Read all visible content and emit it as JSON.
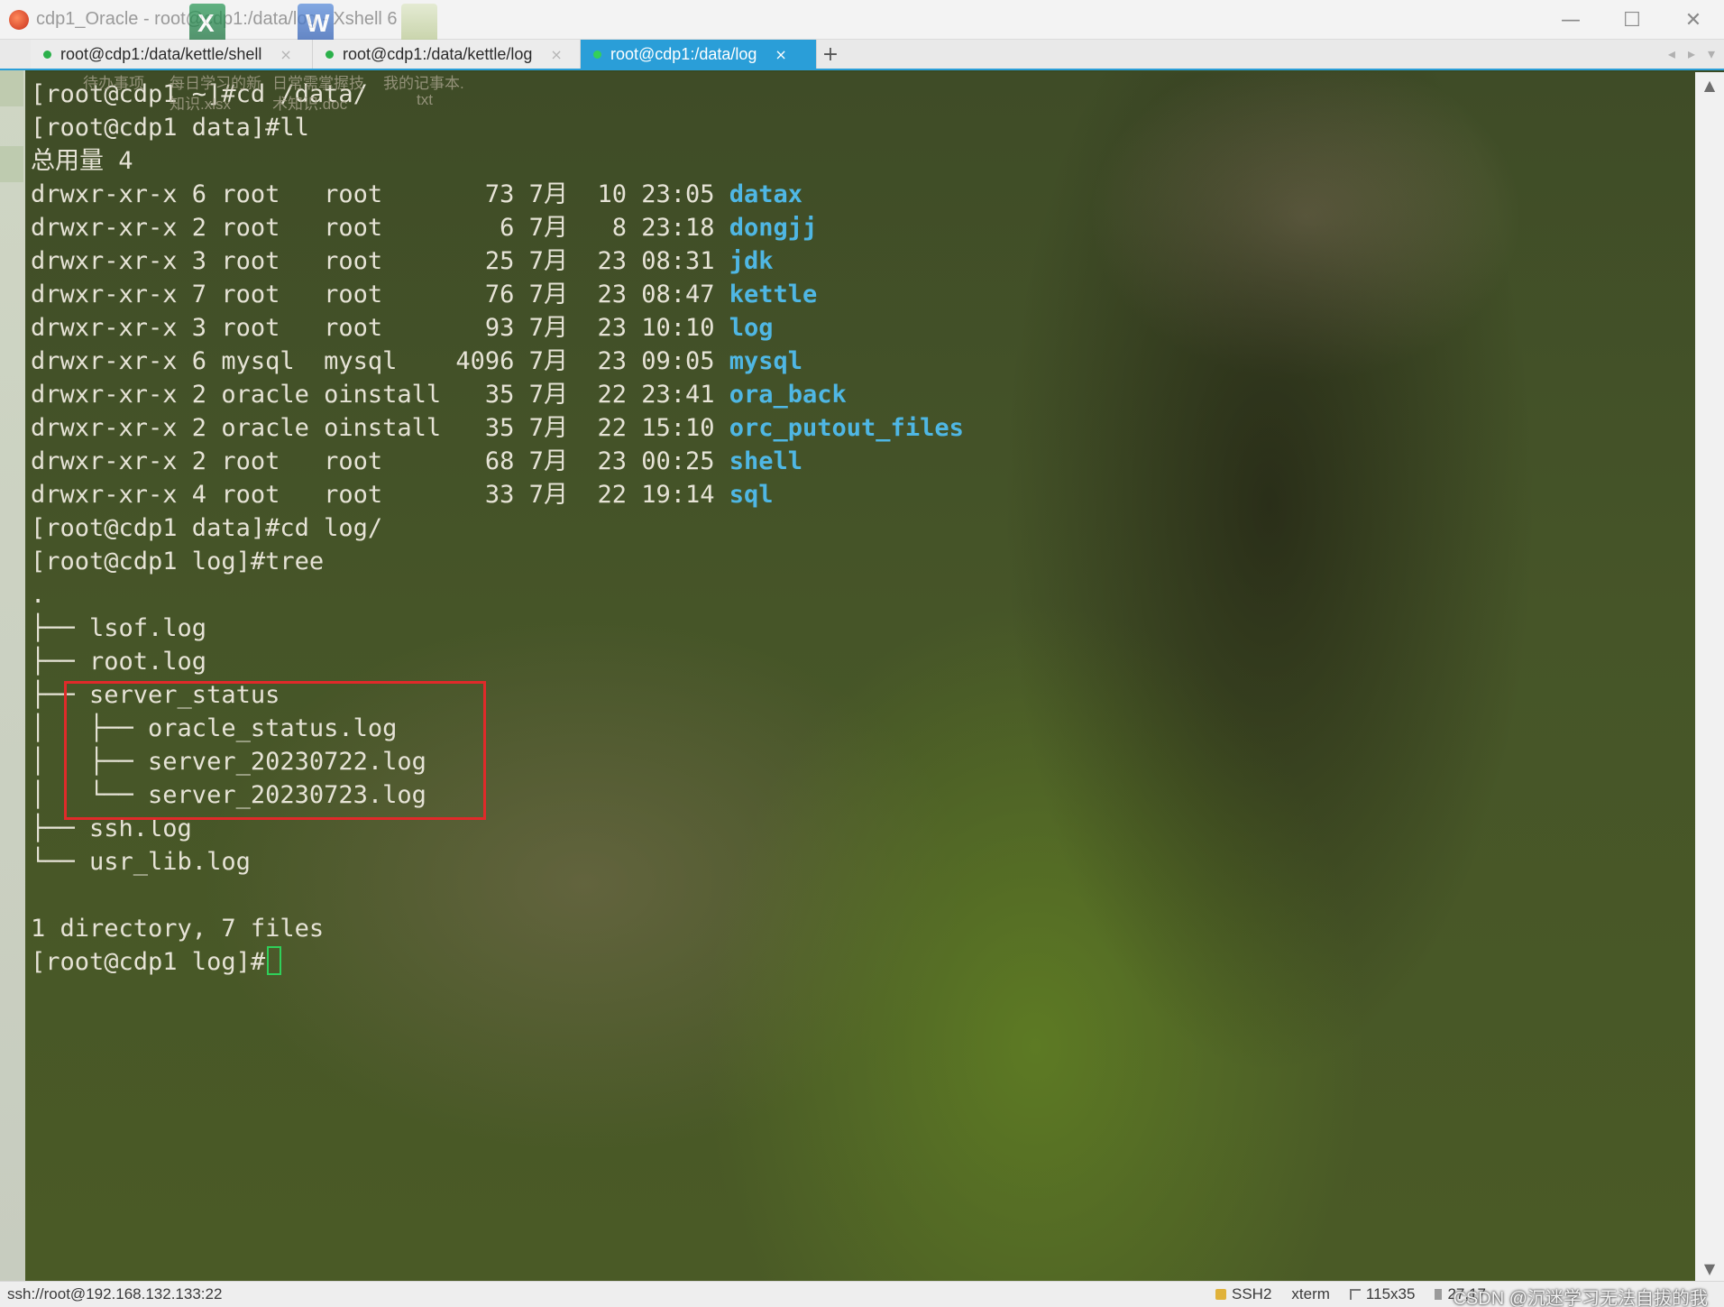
{
  "window": {
    "title": "cdp1_Oracle - root@cdp1:/data/log - Xshell 6",
    "controls": {
      "minimize": "—",
      "maximize": "☐",
      "close": "✕"
    }
  },
  "tabs": [
    {
      "label": "root@cdp1:/data/kettle/shell",
      "close": "×",
      "active": false
    },
    {
      "label": "root@cdp1:/data/kettle/log",
      "close": "×",
      "active": false
    },
    {
      "label": "root@cdp1:/data/log",
      "close": "×",
      "active": true
    }
  ],
  "tab_add": "+",
  "tab_nav": {
    "prev": "◂",
    "next": "▸",
    "menu": "▾"
  },
  "desktop_ghosts": {
    "captions": [
      "待办事项",
      "每日学习的新",
      "日常需掌握技",
      "我的记事本.",
      "知识.xlsx",
      "术知识.doc",
      "txt"
    ],
    "excel_letter": "X",
    "word_letter": "W"
  },
  "terminal": {
    "lines": [
      {
        "text": "[root@cdp1 ~]#cd /data/"
      },
      {
        "text": "[root@cdp1 data]#ll"
      },
      {
        "text": "总用量 4"
      },
      {
        "text": "drwxr-xr-x 6 root   root       73 7月  10 23:05 ",
        "dir": "datax"
      },
      {
        "text": "drwxr-xr-x 2 root   root        6 7月   8 23:18 ",
        "dir": "dongjj"
      },
      {
        "text": "drwxr-xr-x 3 root   root       25 7月  23 08:31 ",
        "dir": "jdk"
      },
      {
        "text": "drwxr-xr-x 7 root   root       76 7月  23 08:47 ",
        "dir": "kettle"
      },
      {
        "text": "drwxr-xr-x 3 root   root       93 7月  23 10:10 ",
        "dir": "log"
      },
      {
        "text": "drwxr-xr-x 6 mysql  mysql    4096 7月  23 09:05 ",
        "dir": "mysql"
      },
      {
        "text": "drwxr-xr-x 2 oracle oinstall   35 7月  22 23:41 ",
        "dir": "ora_back"
      },
      {
        "text": "drwxr-xr-x 2 oracle oinstall   35 7月  22 15:10 ",
        "dir": "orc_putout_files"
      },
      {
        "text": "drwxr-xr-x 2 root   root       68 7月  23 00:25 ",
        "dir": "shell"
      },
      {
        "text": "drwxr-xr-x 4 root   root       33 7月  22 19:14 ",
        "dir": "sql"
      },
      {
        "text": "[root@cdp1 data]#cd log/"
      },
      {
        "text": "[root@cdp1 log]#tree"
      },
      {
        "text": "."
      },
      {
        "text": "├── lsof.log"
      },
      {
        "text": "├── root.log"
      },
      {
        "text": "├── server_status"
      },
      {
        "text": "│   ├── oracle_status.log"
      },
      {
        "text": "│   ├── server_20230722.log"
      },
      {
        "text": "│   └── server_20230723.log"
      },
      {
        "text": "├── ssh.log"
      },
      {
        "text": "└── usr_lib.log"
      },
      {
        "text": ""
      },
      {
        "text": "1 directory, 7 files"
      },
      {
        "text": "[root@cdp1 log]#",
        "cursor": true
      }
    ]
  },
  "scrollbar": {
    "up": "▲",
    "down": "▼"
  },
  "statusbar": {
    "connection": "ssh://root@192.168.132.133:22",
    "protocol": "SSH2",
    "terminal_type": "xterm",
    "size": "115x35",
    "position": "27,17",
    "watermark": "CSDN @沉迷学习无法自拔的我"
  },
  "colors": {
    "accent": "#2a9ed8",
    "directory": "#4fb7e4",
    "highlight_box": "#e02a2a",
    "cursor": "#2fd05a"
  }
}
